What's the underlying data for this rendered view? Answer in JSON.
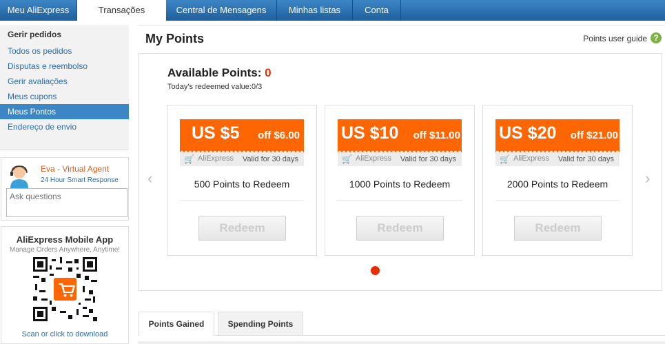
{
  "topnav": {
    "tabs": [
      {
        "label": "Meu AliExpress",
        "active": false
      },
      {
        "label": "Transações",
        "active": true
      },
      {
        "label": "Central de Mensagens",
        "active": false
      },
      {
        "label": "Minhas listas",
        "active": false
      },
      {
        "label": "Conta",
        "active": false
      }
    ]
  },
  "sidebar": {
    "title": "Gerir pedidos",
    "items": [
      {
        "label": "Todos os pedidos"
      },
      {
        "label": "Disputas e reembolso"
      },
      {
        "label": "Gerir avaliações"
      },
      {
        "label": "Meus cupons"
      },
      {
        "label": "Meus Pontos",
        "active": true
      },
      {
        "label": "Endereço de envio"
      }
    ]
  },
  "agent": {
    "name": "Eva - Virtual Agent",
    "subtitle": "24 Hour Smart Response",
    "input_placeholder": "Ask questions"
  },
  "app_promo": {
    "title": "AliExpress Mobile App",
    "subtitle": "Manage Orders Anywhere, Anytime!",
    "link": "Scan or click to download"
  },
  "main": {
    "title": "My Points",
    "guide_link": "Points user guide",
    "guide_icon": "question-icon",
    "available_label": "Available Points:",
    "available_value": "0",
    "redeemed_text": "Today's redeemed value:0/3"
  },
  "coupons": [
    {
      "amount": "US $5",
      "off": "off $6.00",
      "brand": "AliExpress",
      "valid": "Valid for 30 days",
      "points": "500 Points to Redeem",
      "button": "Redeem"
    },
    {
      "amount": "US $10",
      "off": "off $11.00",
      "brand": "AliExpress",
      "valid": "Valid for 30 days",
      "points": "1000 Points to Redeem",
      "button": "Redeem"
    },
    {
      "amount": "US $20",
      "off": "off $21.00",
      "brand": "AliExpress",
      "valid": "Valid for 30 days",
      "points": "2000 Points to Redeem",
      "button": "Redeem"
    }
  ],
  "carousel": {
    "prev_icon": "chevron-left-icon",
    "next_icon": "chevron-right-icon",
    "page_indicator_color": "#e62e04"
  },
  "bottom_tabs": [
    {
      "label": "Points Gained",
      "active": true
    },
    {
      "label": "Spending Points",
      "active": false
    }
  ],
  "colors": {
    "nav": "#2a6fb0",
    "accent": "#fe6604",
    "link": "#2b6cae",
    "points_value": "#e62e04"
  }
}
